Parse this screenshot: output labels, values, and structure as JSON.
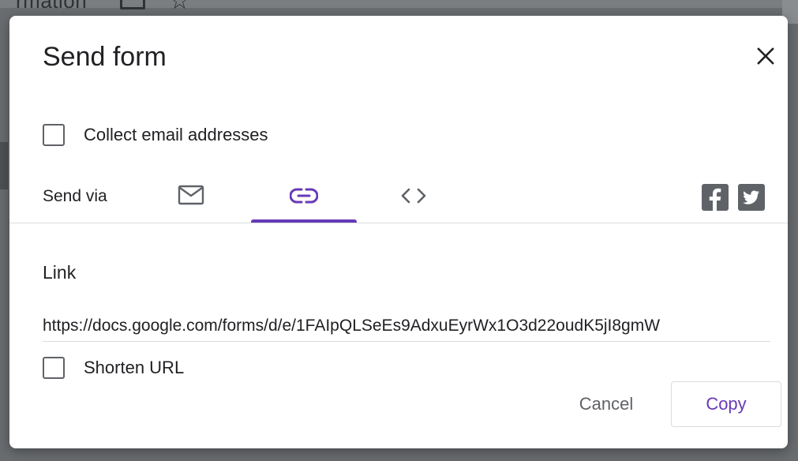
{
  "background": {
    "partial_title": "rmation"
  },
  "dialog": {
    "title": "Send form",
    "collect_email_label": "Collect email addresses",
    "collect_email_checked": false,
    "send_via_label": "Send via",
    "tabs": [
      {
        "name": "email",
        "icon": "email-icon",
        "selected": false
      },
      {
        "name": "link",
        "icon": "link-icon",
        "selected": true
      },
      {
        "name": "embed",
        "icon": "code-icon",
        "selected": false
      }
    ],
    "social": [
      {
        "name": "facebook",
        "icon": "facebook-icon"
      },
      {
        "name": "twitter",
        "icon": "twitter-icon"
      }
    ],
    "link_section_label": "Link",
    "link_value": "https://docs.google.com/forms/d/e/1FAIpQLSeEs9AdxuEyrWx1O3d22oudK5jI8gmW",
    "shorten_url_label": "Shorten URL",
    "shorten_url_checked": false,
    "cancel_label": "Cancel",
    "copy_label": "Copy"
  },
  "colors": {
    "accent": "#673ab7",
    "text_primary": "#202124",
    "text_secondary": "#5f6368",
    "divider": "#dadce0"
  }
}
